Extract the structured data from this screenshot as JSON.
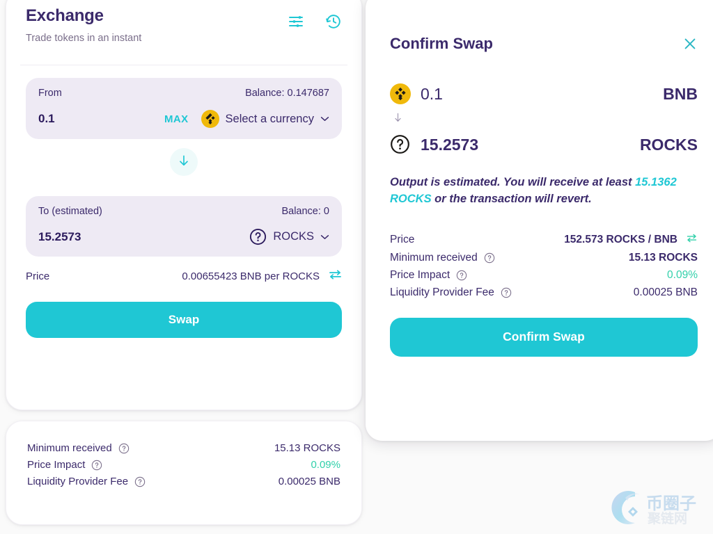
{
  "exchange": {
    "title": "Exchange",
    "subtitle": "Trade tokens in an instant",
    "settings_icon": "sliders-icon",
    "history_icon": "history-clock-icon",
    "from": {
      "label": "From",
      "balance_label": "Balance: 0.147687",
      "amount": "0.1",
      "max_label": "MAX",
      "currency": "Select a currency",
      "currency_icon": "bnb-token-icon"
    },
    "switch_icon": "arrow-down-icon",
    "to": {
      "label": "To (estimated)",
      "balance_label": "Balance: 0",
      "amount": "15.2573",
      "currency": "ROCKS",
      "currency_icon": "unknown-token-question-icon"
    },
    "price": {
      "label": "Price",
      "value": "0.00655423 BNB per ROCKS",
      "toggle_icon": "swap-direction-icon"
    },
    "swap_button": "Swap"
  },
  "details": {
    "rows": [
      {
        "label": "Minimum received",
        "value": "15.13 ROCKS",
        "help": "help-icon",
        "green": false
      },
      {
        "label": "Price Impact",
        "value": "0.09%",
        "help": "help-icon",
        "green": true
      },
      {
        "label": "Liquidity Provider Fee",
        "value": "0.00025 BNB",
        "help": "help-icon",
        "green": false
      }
    ]
  },
  "modal": {
    "title": "Confirm Swap",
    "close_icon": "close-icon",
    "from": {
      "icon": "bnb-token-icon",
      "amount": "0.1",
      "symbol": "BNB"
    },
    "arrow_icon": "arrow-down-icon",
    "to": {
      "icon": "unknown-token-question-icon",
      "amount": "15.2573",
      "symbol": "ROCKS"
    },
    "note": {
      "prefix": "Output is estimated. You will receive at least ",
      "highlight": "15.1362 ROCKS",
      "suffix": " or the transaction will revert."
    },
    "rows": [
      {
        "label": "Price",
        "value": "152.573 ROCKS / BNB",
        "help": null,
        "refresh": "swap-direction-icon",
        "green": false,
        "bold": true
      },
      {
        "label": "Minimum received",
        "value": "15.13 ROCKS",
        "help": "help-icon",
        "refresh": null,
        "green": false,
        "bold": true
      },
      {
        "label": "Price Impact",
        "value": "0.09%",
        "help": "help-icon",
        "refresh": null,
        "green": true,
        "bold": false
      },
      {
        "label": "Liquidity Provider Fee",
        "value": "0.00025 BNB",
        "help": "help-icon",
        "refresh": null,
        "green": false,
        "bold": false
      }
    ],
    "confirm_button": "Confirm Swap"
  },
  "watermark": {
    "text": "币圈子",
    "sub_text": "聚链网"
  },
  "colors": {
    "primary_text": "#3b2a6b",
    "accent": "#1fc7d4",
    "success": "#31d0aa",
    "panel_bg": "#eeeaf4",
    "card_bg": "#ffffff",
    "page_bg": "#fafafa"
  }
}
